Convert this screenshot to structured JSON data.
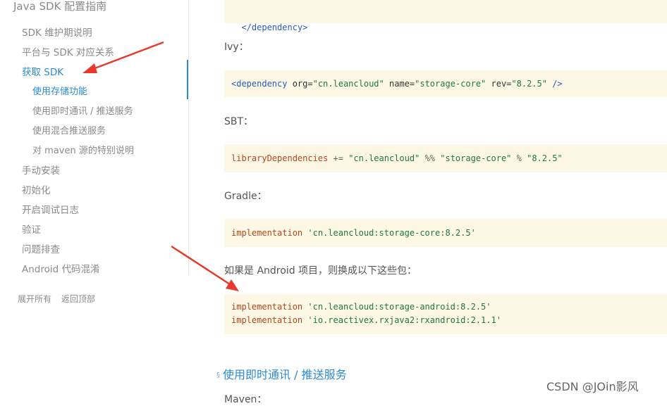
{
  "sidebar": {
    "title": "Java SDK 配置指南",
    "items": [
      {
        "label": "SDK 维护期说明"
      },
      {
        "label": "平台与 SDK 对应关系"
      },
      {
        "label": "获取 SDK"
      },
      {
        "label": "使用存储功能"
      },
      {
        "label": "使用即时通讯 / 推送服务"
      },
      {
        "label": "使用混合推送服务"
      },
      {
        "label": "对 maven 源的特别说明"
      },
      {
        "label": "手动安装"
      },
      {
        "label": "初始化"
      },
      {
        "label": "开启调试日志"
      },
      {
        "label": "验证"
      },
      {
        "label": "问题排查"
      },
      {
        "label": "Android 代码混淆"
      }
    ],
    "footer": {
      "expand_all": "展开所有",
      "back_to_top": "返回顶部"
    }
  },
  "main": {
    "maven_close": {
      "line": "</dependency>"
    },
    "ivy": {
      "label": "Ivy：",
      "tag_open": "<dependency",
      "attr1": " org=",
      "val1": "\"cn.leancloud\"",
      "attr2": " name=",
      "val2": "\"storage-core\"",
      "attr3": " rev=",
      "val3": "\"8.2.5\"",
      "tag_close": " />"
    },
    "sbt": {
      "label": "SBT：",
      "kw": "libraryDependencies",
      "op1": " += ",
      "s1": "\"cn.leancloud\"",
      "op2": " %% ",
      "s2": "\"storage-core\"",
      "op3": " % ",
      "s3": "\"8.2.5\""
    },
    "gradle": {
      "label": "Gradle：",
      "kw": "implementation",
      "s1": "'cn.leancloud:storage-core:8.2.5'"
    },
    "android": {
      "label": "如果是 Android 项目，则换成以下这些包：",
      "kw1": "implementation",
      "s1": "'cn.leancloud:storage-android:8.2.5'",
      "kw2": "implementation",
      "s2": "'io.reactivex.rxjava2:rxandroid:2.1.1'"
    },
    "section_heading": {
      "symbol": "§",
      "text": "使用即时通讯 / 推送服务"
    },
    "partial_next_label": "Maven："
  },
  "watermark": "CSDN @JOin影风",
  "colors": {
    "accent": "#2a8bd2",
    "code_bg": "#fdf8e6",
    "arrow": "#e8392c"
  }
}
